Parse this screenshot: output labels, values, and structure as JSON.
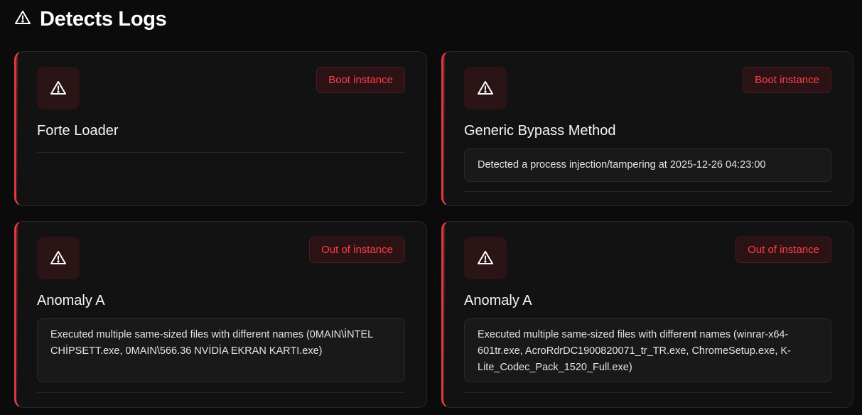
{
  "page": {
    "title": "Detects Logs",
    "title_icon": "warning-triangle-icon"
  },
  "colors": {
    "accent": "#e03a40",
    "badge_text": "#ff3f45",
    "background": "#0b0b0b",
    "card": "#121212"
  },
  "logs": [
    {
      "icon": "warning-triangle-icon",
      "badge": "Boot instance",
      "title": "Forte Loader",
      "detail": ""
    },
    {
      "icon": "warning-triangle-icon",
      "badge": "Boot instance",
      "title": "Generic Bypass Method",
      "detail": "Detected a process injection/tampering at 2025-12-26 04:23:00"
    },
    {
      "icon": "warning-triangle-icon",
      "badge": "Out of instance",
      "title": "Anomaly A",
      "detail": "Executed multiple same-sized files with different names (0MAIN\\İNTEL CHİPSETT.exe, 0MAIN\\566.36 NVİDİA EKRAN KARTI.exe)"
    },
    {
      "icon": "warning-triangle-icon",
      "badge": "Out of instance",
      "title": "Anomaly A",
      "detail": "Executed multiple same-sized files with different names (winrar-x64-601tr.exe, AcroRdrDC1900820071_tr_TR.exe, ChromeSetup.exe, K-Lite_Codec_Pack_1520_Full.exe)"
    }
  ]
}
